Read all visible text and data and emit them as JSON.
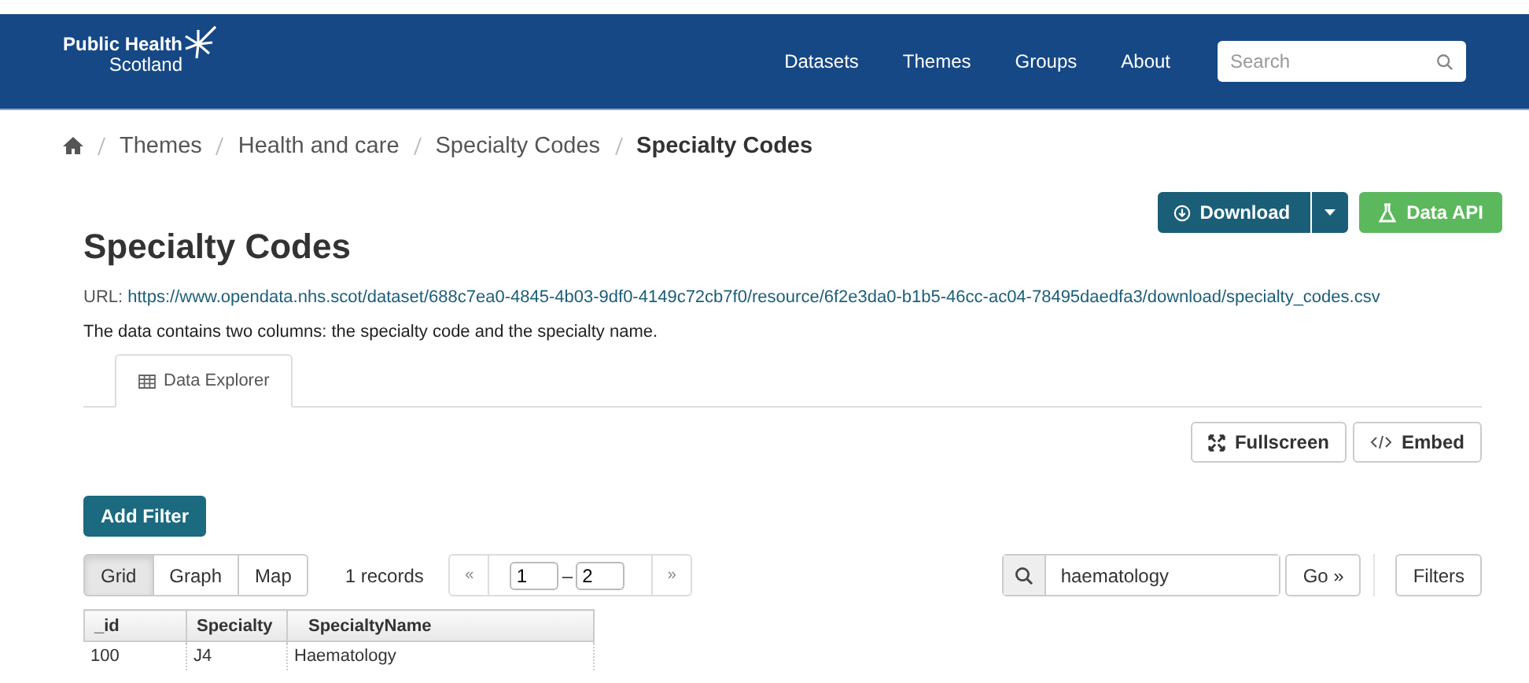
{
  "header": {
    "logo": {
      "line1": "Public Health",
      "line2": "Scotland"
    },
    "nav": [
      "Datasets",
      "Themes",
      "Groups",
      "About"
    ],
    "search": {
      "placeholder": "Search"
    }
  },
  "breadcrumb": [
    {
      "label": "Themes",
      "current": false
    },
    {
      "label": "Health and care",
      "current": false
    },
    {
      "label": "Specialty Codes",
      "current": false
    },
    {
      "label": "Specialty Codes",
      "current": true
    }
  ],
  "title": "Specialty Codes",
  "actions": [
    {
      "label": "Download",
      "kind": "dropdown"
    },
    {
      "label": "Data API",
      "kind": "api"
    }
  ],
  "url": {
    "label": "URL:",
    "link": "https://www.opendata.nhs.scot/dataset/688c7ea0-4845-4b03-9df0-4149c72cb7f0/resource/6f2e3da0-b1b5-46cc-ac04-78495daedfa3/download/specialty_codes.csv"
  },
  "description": "The data contains two columns: the specialty code and the specialty name.",
  "tabs": [
    {
      "label": "Data Explorer",
      "selected": true
    }
  ],
  "view_actions": [
    {
      "label": "Fullscreen",
      "kind": "fullscreen"
    },
    {
      "label": "Embed",
      "kind": "embed"
    }
  ],
  "add_filter": "Add Filter",
  "views": [
    {
      "label": "Grid",
      "selected": true
    },
    {
      "label": "Graph",
      "selected": false
    },
    {
      "label": "Map",
      "selected": false
    }
  ],
  "record_count": "1 records",
  "pager": {
    "prev": "«",
    "from": "1",
    "separator": "–",
    "to": "2",
    "next": "»"
  },
  "query": {
    "value": "haematology",
    "go": "Go »",
    "filters": "Filters"
  },
  "table": {
    "columns": [
      "_id",
      "Specialty",
      "SpecialtyName"
    ],
    "rows": [
      [
        "100",
        "J4",
        "Haematology"
      ]
    ]
  }
}
